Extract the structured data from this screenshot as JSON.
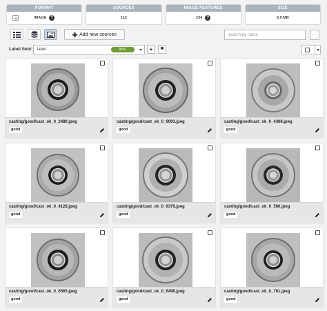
{
  "stats": [
    {
      "header": "FORMAT",
      "value": "IMAGE",
      "icon": "image-icon",
      "help": "?"
    },
    {
      "header": "SOURCES",
      "value": "112"
    },
    {
      "header": "IMAGE FEATURES",
      "value": "234",
      "help": "?"
    },
    {
      "header": "SIZE",
      "value": "8.0 MB"
    }
  ],
  "toolbar": {
    "add_label": "Add new sources",
    "search_placeholder": "Search by name"
  },
  "label_field": {
    "label": "Label field:",
    "value": "label",
    "badge": "ABC",
    "plus": "+",
    "clear": "✖"
  },
  "colors": {
    "badge": "#6d9b35",
    "active_view": "#c9d3dd",
    "stat_header": "#a9b3bd"
  },
  "images": [
    {
      "name": "casting/good/cast_ok_0_2480.jpeg",
      "label": "good"
    },
    {
      "name": "casting/good/cast_ok_0_6093.jpeg",
      "label": "good"
    },
    {
      "name": "casting/good/cast_ok_0_4368.jpeg",
      "label": "good"
    },
    {
      "name": "casting/good/cast_ok_0_4128.jpeg",
      "label": "good"
    },
    {
      "name": "casting/good/cast_ok_0_6379.jpeg",
      "label": "good"
    },
    {
      "name": "casting/good/cast_ok_0_560.jpeg",
      "label": "good"
    },
    {
      "name": "casting/good/cast_ok_0_6565.jpeg",
      "label": "good"
    },
    {
      "name": "casting/good/cast_ok_0_6498.jpeg",
      "label": "good"
    },
    {
      "name": "casting/good/cast_ok_0_761.jpeg",
      "label": "good"
    }
  ]
}
